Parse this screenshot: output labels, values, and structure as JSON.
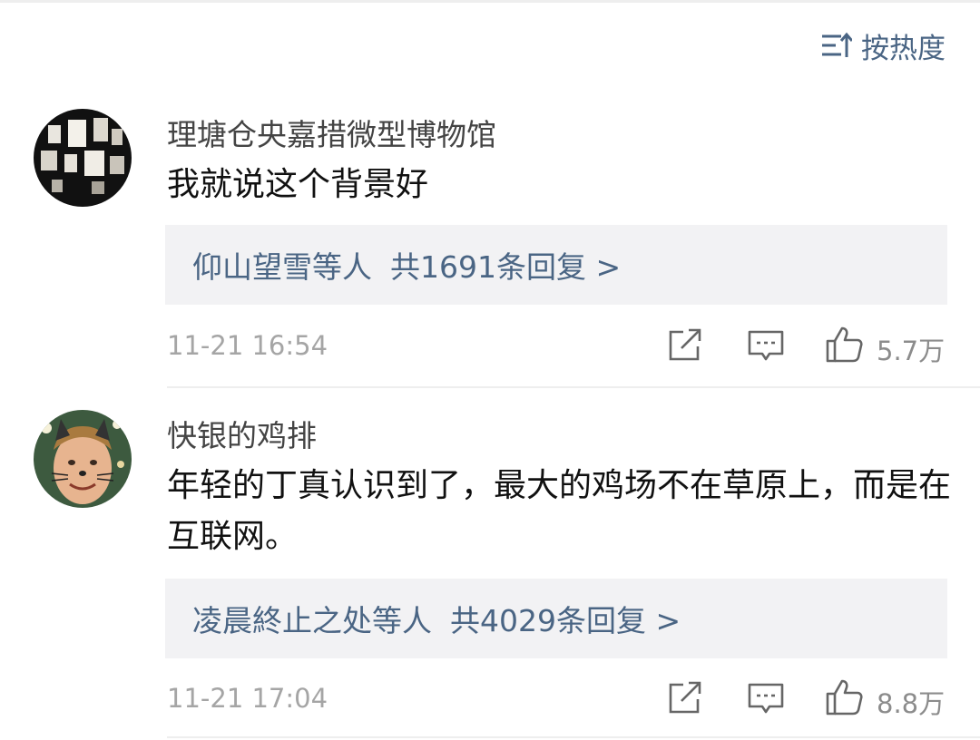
{
  "sort": {
    "label": "按热度",
    "icon": "sort-icon"
  },
  "comments": [
    {
      "author": "理塘仓央嘉措微型博物馆",
      "text": "我就说这个背景好",
      "replies": {
        "names": "仰山望雪等人",
        "count_label": "共1691条回复 >"
      },
      "time": "11-21 16:54",
      "likes": "5.7万",
      "avatar_icon": "lantern-avatar"
    },
    {
      "author": "快银的鸡排",
      "text": "年轻的丁真认识到了，最大的鸡场不在草原上，而是在互联网。",
      "replies": {
        "names": "凌晨終止之处等人",
        "count_label": "共4029条回复 >"
      },
      "time": "11-21 17:04",
      "likes": "8.8万",
      "avatar_icon": "cat-face-avatar"
    }
  ],
  "colors": {
    "link_blue": "#4a6584",
    "reply_bg": "#f2f2f4",
    "muted": "#a5a5a5"
  }
}
